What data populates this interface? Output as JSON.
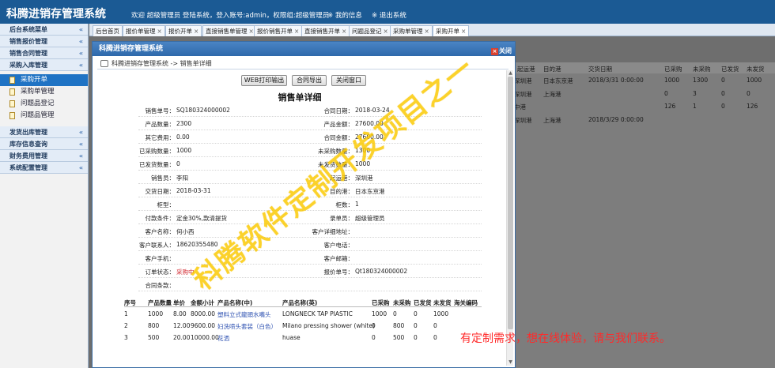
{
  "topbar": {
    "title": "科腾进销存管理系统",
    "welcome": "欢迎 超级管理员 登陆系统，登入账号:admin，权限组:超级管理员",
    "my_info": "※ 我的信息",
    "logout": "※ 退出系统"
  },
  "sidebar": {
    "chevron": "«",
    "sections": [
      {
        "label": "后台系统菜单"
      },
      {
        "label": "销售报价管理"
      },
      {
        "label": "销售合同管理"
      },
      {
        "label": "采购入库管理"
      }
    ],
    "items": [
      {
        "label": "采购开单"
      },
      {
        "label": "采购单管理"
      },
      {
        "label": "问题品登记"
      },
      {
        "label": "问题品管理"
      }
    ],
    "sections_after": [
      {
        "label": "发货出库管理"
      },
      {
        "label": "库存信息查询"
      },
      {
        "label": "财务费用管理"
      },
      {
        "label": "系统配置管理"
      }
    ]
  },
  "tabs": [
    {
      "label": "后台首页"
    },
    {
      "label": "报价单管理"
    },
    {
      "label": "报价开单"
    },
    {
      "label": "直接销售单管理"
    },
    {
      "label": "报价销售开单"
    },
    {
      "label": "直接销售开单"
    },
    {
      "label": "问题品登记"
    },
    {
      "label": "采购单管理"
    },
    {
      "label": "采购开单"
    }
  ],
  "tab_close": "×",
  "background_table": {
    "headers": [
      "起运港",
      "目的港",
      "交货日期",
      "已采购",
      "未采购",
      "已发货",
      "未发货"
    ],
    "rows": [
      [
        "深圳港",
        "日本东京港",
        "2018/3/31 0:00:00",
        "1000",
        "1300",
        "0",
        "1000"
      ],
      [
        "深圳港",
        "上海港",
        "",
        "0",
        "3",
        "0",
        "0"
      ],
      [
        "中港",
        "",
        "",
        "126",
        "1",
        "0",
        "126"
      ],
      [
        "深圳港",
        "上海港",
        "2018/3/29 0:00:00",
        "",
        "",
        "",
        ""
      ]
    ]
  },
  "modal": {
    "title": "科腾进销存管理系统",
    "close": "关闭",
    "close_icon": "×",
    "breadcrumb": "科腾进销存管理系统 -> 销售单详细",
    "buttons": {
      "print": "WEB打印输出",
      "export": "合同导出",
      "close": "关闭窗口"
    },
    "doc_title": "销售单详细",
    "scroll_up": "▲",
    "scroll_down": "▼",
    "fields": {
      "order_no_label": "销售单号：",
      "order_no": "SQ180324000002",
      "contract_date_label": "合同日期：",
      "contract_date": "2018-03-24",
      "qty_label": "产品数量：",
      "qty": "2300",
      "amount_label": "产品金额：",
      "amount": "27600.00",
      "other_fee_label": "其它费用：",
      "other_fee": "0.00",
      "contract_amount_label": "合同金额：",
      "contract_amount": "27600.00",
      "purchased_label": "已采购数量：",
      "purchased": "1000",
      "not_purchased_label": "未采购数量：",
      "not_purchased": "1300",
      "shipped_label": "已发货数量：",
      "shipped": "0",
      "not_shipped_label": "未发货数量：",
      "not_shipped": "1000",
      "sales_label": "销售员：",
      "sales": "李阳",
      "from_port_label": "起运港：",
      "from_port": "深圳港",
      "delivery_label": "交货日期：",
      "delivery": "2018-03-31",
      "to_port_label": "目的港：",
      "to_port": "日本东京港",
      "container_type_label": "柜型：",
      "container_type": "",
      "container_count_label": "柜数：",
      "container_count": "1",
      "payment_label": "付款条件：",
      "payment": "定金30%,款清提货",
      "entry_label": "录单员：",
      "entry": "超级管理员",
      "customer_label": "客户名称：",
      "customer": "何小西",
      "customer_addr_label": "客户详细地址：",
      "customer_addr": "",
      "contact_label": "客户联系人：",
      "contact": "18620355480",
      "phone_label": "客户电话：",
      "phone": "",
      "mobile_label": "客户手机：",
      "mobile": "",
      "email_label": "客户邮箱：",
      "email": "",
      "status_label": "订单状态：",
      "status": "采购中",
      "quote_no_label": "报价单号：",
      "quote_no": "Qt180324000002",
      "terms_label": "合同条款：",
      "terms": ""
    },
    "detail_headers": [
      "序号",
      "产品数量",
      "单价",
      "金额小计",
      "产品名称(中)",
      "产品名称(英)",
      "已采购",
      "未采购",
      "已发货",
      "未发货",
      "海关编码"
    ],
    "detail_rows": [
      [
        "1",
        "1000",
        "8.00",
        "8000.00",
        "塑料立式龍頭水嘴头",
        "LONGNECK TAP PIASTIC",
        "1000",
        "0",
        "0",
        "1000",
        ""
      ],
      [
        "2",
        "800",
        "12.00",
        "9600.00",
        "妇洗喷头套装（白色）",
        "Milano pressing shower (white)",
        "0",
        "800",
        "0",
        "0",
        ""
      ],
      [
        "3",
        "500",
        "20.00",
        "10000.00",
        "花洒",
        "huase",
        "0",
        "500",
        "0",
        "0",
        ""
      ]
    ]
  },
  "watermark": "科腾软件定制开发项目之一",
  "promo": "有定制需求，想在线体验，请与我们联系。"
}
